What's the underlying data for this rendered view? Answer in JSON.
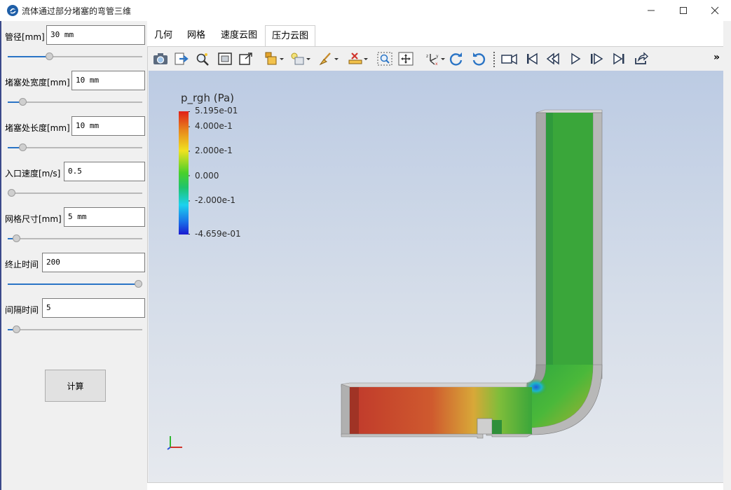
{
  "window": {
    "title": "流体通过部分堵塞的弯管三维"
  },
  "params": [
    {
      "label": "管径[mm]",
      "value": "30 mm",
      "slider": 0.3
    },
    {
      "label": "堵塞处宽度[mm]",
      "value": "10 mm",
      "slider": 0.09
    },
    {
      "label": "堵塞处长度[mm]",
      "value": "10 mm",
      "slider": 0.09
    },
    {
      "label": "入口速度[m/s]",
      "value": "0.5",
      "slider": 0.0
    },
    {
      "label": "网格尺寸[mm]",
      "value": "5 mm",
      "slider": 0.04
    },
    {
      "label": "终止时间",
      "value": "200",
      "slider": 1.0
    },
    {
      "label": "间隔时间",
      "value": "5",
      "slider": 0.04
    }
  ],
  "calc_button": "计算",
  "tabs": [
    "几何",
    "网格",
    "速度云图",
    "压力云图"
  ],
  "active_tab": 3,
  "toolbar_more": "»",
  "legend": {
    "title": "p_rgh (Pa)",
    "labels": [
      "5.195e-01",
      "4.000e-1",
      "2.000e-1",
      "0.000",
      "-2.000e-1",
      "-4.659e-01"
    ]
  },
  "colors": {
    "accent": "#2a74c5",
    "inlet_high": "#c0392b",
    "pipe_mid": "#3aa63a"
  }
}
